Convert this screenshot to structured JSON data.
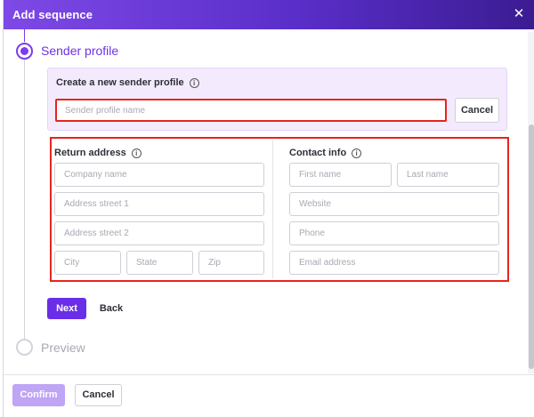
{
  "modal": {
    "title": "Add sequence",
    "close_icon": "close-icon"
  },
  "steps": [
    {
      "label": "Sender profile",
      "state": "active"
    },
    {
      "label": "Preview",
      "state": "inactive"
    }
  ],
  "new_profile": {
    "title": "Create a new sender profile",
    "input_placeholder": "Sender profile name",
    "cancel_label": "Cancel"
  },
  "return_address": {
    "title": "Return address",
    "company_placeholder": "Company name",
    "street1_placeholder": "Address street 1",
    "street2_placeholder": "Address street 2",
    "city_placeholder": "City",
    "state_placeholder": "State",
    "zip_placeholder": "Zip"
  },
  "contact_info": {
    "title": "Contact info",
    "first_name_placeholder": "First name",
    "last_name_placeholder": "Last name",
    "website_placeholder": "Website",
    "phone_placeholder": "Phone",
    "email_placeholder": "Email address"
  },
  "actions": {
    "next_label": "Next",
    "back_label": "Back"
  },
  "footer": {
    "confirm_label": "Confirm",
    "cancel_label": "Cancel"
  },
  "colors": {
    "accent": "#6a2ee8",
    "highlight": "#e8241c",
    "panel": "#f3ebfd"
  }
}
